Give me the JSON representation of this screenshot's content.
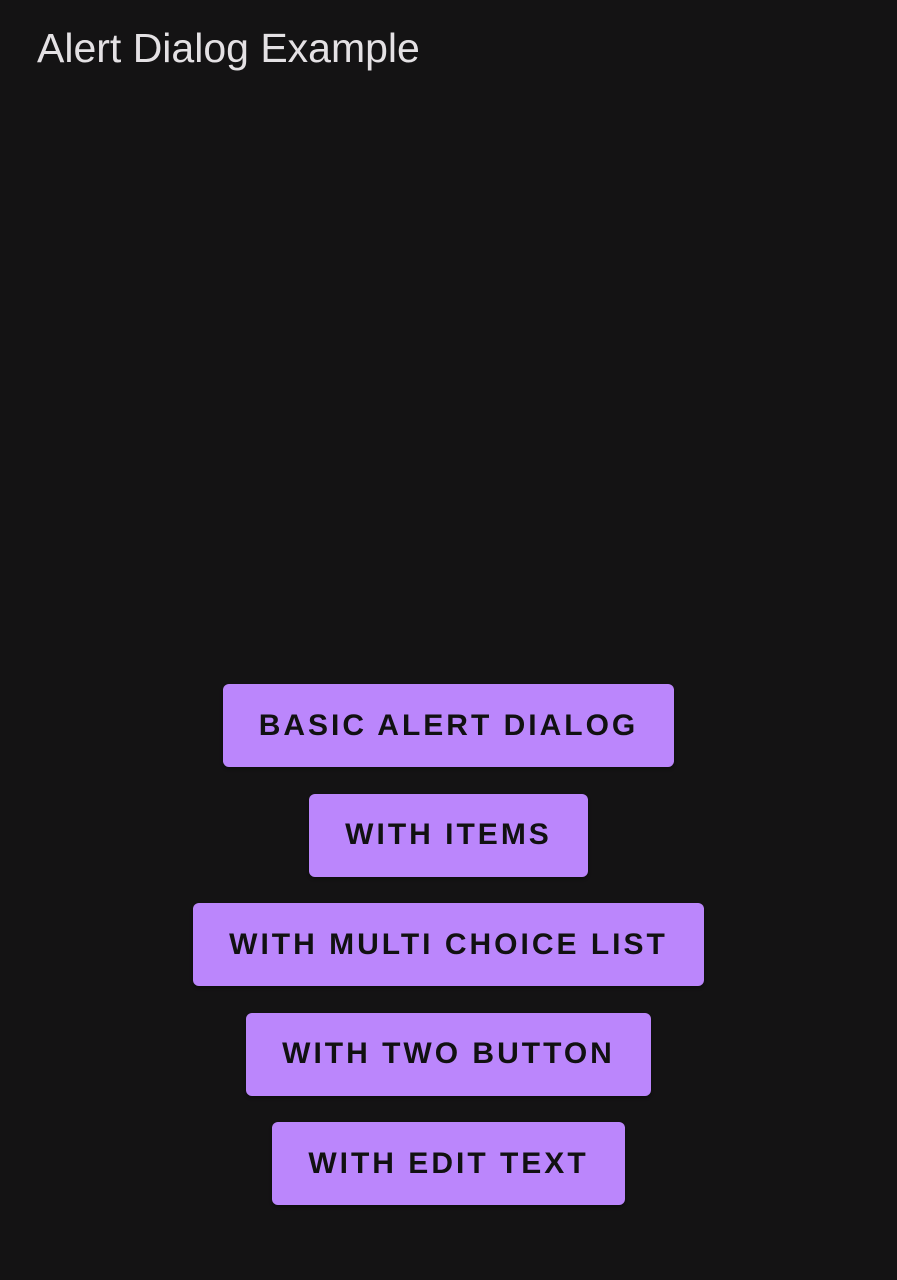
{
  "app_bar": {
    "title": "Alert Dialog Example"
  },
  "buttons": [
    {
      "label": "BASIC ALERT DIALOG"
    },
    {
      "label": "WITH ITEMS"
    },
    {
      "label": "WITH MULTI CHOICE LIST"
    },
    {
      "label": "WITH TWO BUTTON"
    },
    {
      "label": "WITH EDIT TEXT"
    }
  ],
  "colors": {
    "background": "#141314",
    "button": "#bb86fc",
    "title_text": "#e4e1e4",
    "button_text": "#111111"
  }
}
